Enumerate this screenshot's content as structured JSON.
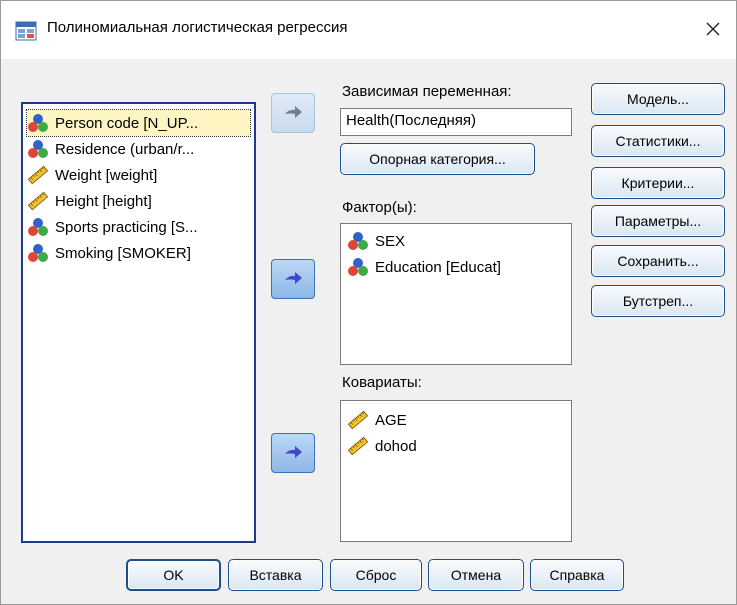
{
  "window": {
    "title": "Полиномиальная логистическая регрессия",
    "icon": "spss-dialog-icon",
    "close_icon": "close-icon"
  },
  "source_list": {
    "items": [
      {
        "label": "Person code [N_UP...",
        "icon": "nominal-icon",
        "selected": true
      },
      {
        "label": "Residence (urban/r...",
        "icon": "nominal-icon",
        "selected": false
      },
      {
        "label": "Weight [weight]",
        "icon": "scale-ruler-icon",
        "selected": false
      },
      {
        "label": "Height [height]",
        "icon": "scale-ruler-icon",
        "selected": false
      },
      {
        "label": "Sports practicing [S...",
        "icon": "nominal-icon",
        "selected": false
      },
      {
        "label": "Smoking [SMOKER]",
        "icon": "nominal-icon",
        "selected": false
      }
    ]
  },
  "dependent": {
    "label": "Зависимая переменная:",
    "value": "Health(Последняя)",
    "reference_button": "Опорная категория..."
  },
  "factors": {
    "label": "Фактор(ы):",
    "items": [
      {
        "label": "SEX",
        "icon": "nominal-icon"
      },
      {
        "label": "Education [Educat]",
        "icon": "nominal-icon"
      }
    ]
  },
  "covariates": {
    "label": "Ковариаты:",
    "items": [
      {
        "label": "AGE",
        "icon": "scale-ruler-icon"
      },
      {
        "label": "dohod",
        "icon": "scale-ruler-icon"
      }
    ]
  },
  "side_buttons": [
    "Модель...",
    "Статистики...",
    "Критерии...",
    "Параметры...",
    "Сохранить...",
    "Бутстреп..."
  ],
  "bottom_buttons": [
    "OK",
    "Вставка",
    "Сброс",
    "Отмена",
    "Справка"
  ],
  "colors": {
    "accent": "#1c4e8c",
    "selection": "#fdf6c2",
    "arrow": "#3f48cc"
  }
}
